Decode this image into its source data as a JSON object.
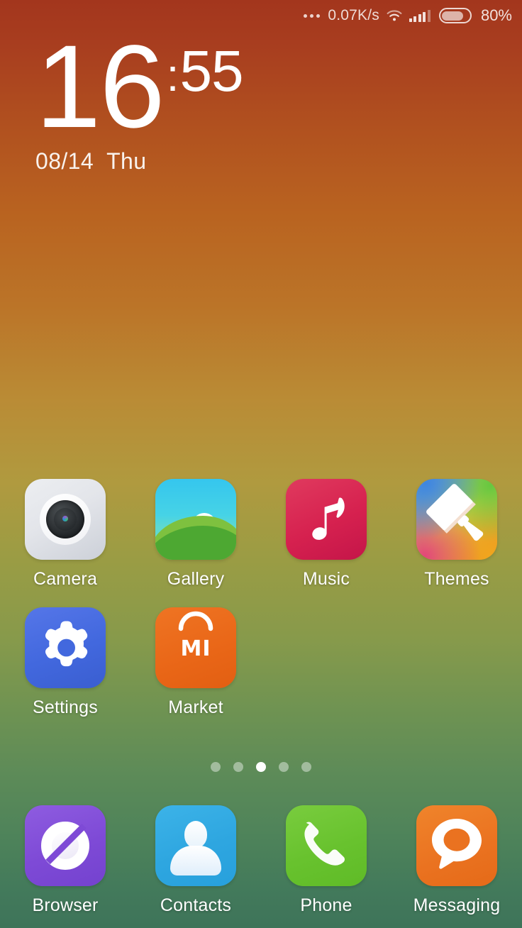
{
  "status_bar": {
    "dots_icon": "more-dots-icon",
    "network_speed": "0.07K/s",
    "wifi_icon": "wifi-icon",
    "signal_icon": "cellular-signal-icon",
    "battery_icon": "battery-icon",
    "battery_percent": "80%",
    "battery_level": 80
  },
  "clock": {
    "hours": "16",
    "separator": ":",
    "minutes": "55",
    "date": "08/14",
    "day_of_week": "Thu"
  },
  "home_screen": {
    "rows": [
      [
        {
          "label": "Camera",
          "icon": "camera-icon",
          "color": "#e3e5ea"
        },
        {
          "label": "Gallery",
          "icon": "gallery-icon",
          "color": "#46d3e6"
        },
        {
          "label": "Music",
          "icon": "music-icon",
          "color": "#d6214f"
        },
        {
          "label": "Themes",
          "icon": "themes-icon",
          "color": "#d9d24a"
        }
      ],
      [
        {
          "label": "Settings",
          "icon": "settings-icon",
          "color": "#4268de"
        },
        {
          "label": "Market",
          "icon": "market-icon",
          "color": "#e96617"
        }
      ]
    ]
  },
  "page_indicator": {
    "total_pages": 5,
    "current_page": 3
  },
  "dock": {
    "items": [
      {
        "label": "Browser",
        "icon": "browser-icon",
        "color": "#7e4ad6"
      },
      {
        "label": "Contacts",
        "icon": "contacts-icon",
        "color": "#2ea6e0"
      },
      {
        "label": "Phone",
        "icon": "phone-icon",
        "color": "#68c22e"
      },
      {
        "label": "Messaging",
        "icon": "messaging-icon",
        "color": "#ea7220"
      }
    ]
  },
  "market_icon": {
    "logo_text": "MI"
  },
  "wallpaper": {
    "top_color": "#a3361d",
    "mid_color": "#ba8b35",
    "bottom_color": "#3e7459"
  }
}
